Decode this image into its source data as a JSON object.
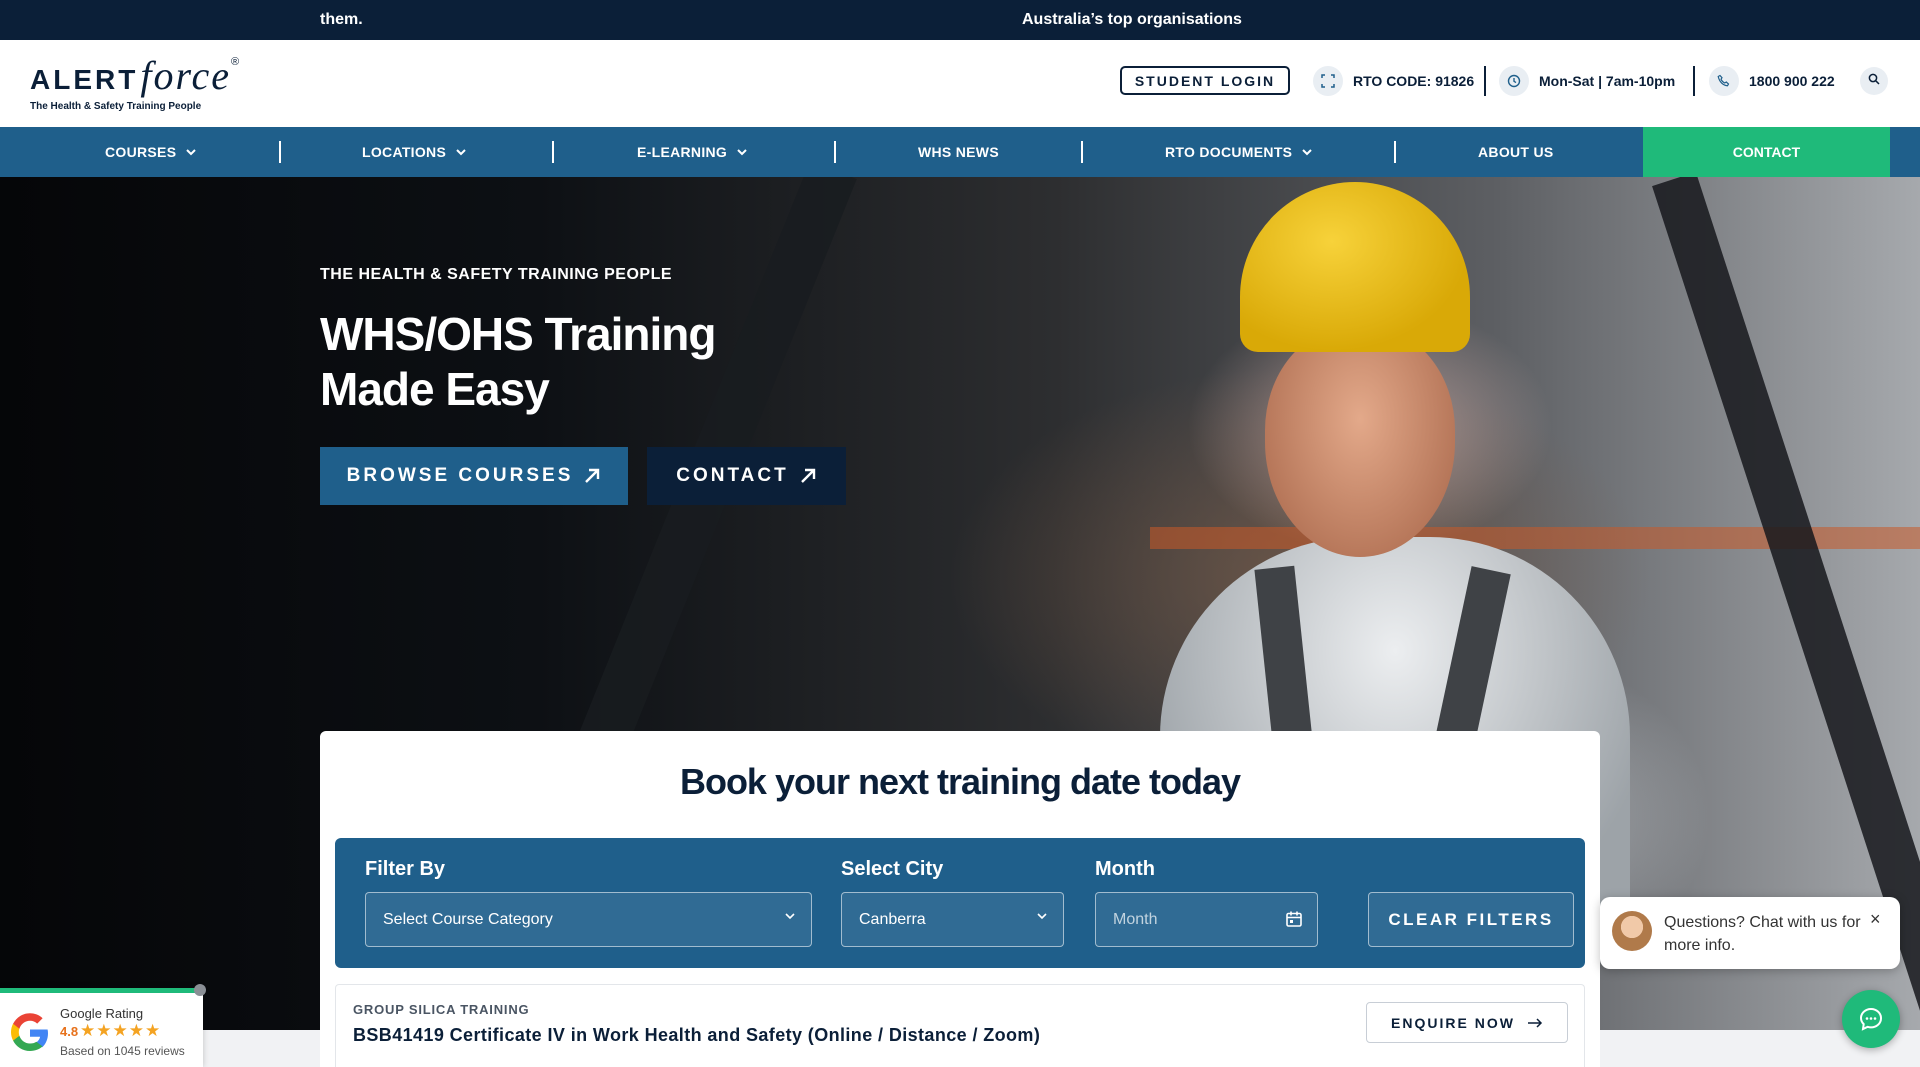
{
  "ticker": {
    "left_text": "them.",
    "right_text": "Australia’s top organisations"
  },
  "header": {
    "logo_word_alert": "ALERT",
    "logo_word_force": "force",
    "logo_reg": "®",
    "logo_tagline": "The Health & Safety Training People",
    "student_login": "STUDENT LOGIN",
    "rto_code": "RTO CODE: 91826",
    "hours": "Mon-Sat | 7am-10pm",
    "phone": "1800 900 222"
  },
  "nav": {
    "items": [
      {
        "label": "COURSES",
        "dropdown": true
      },
      {
        "label": "LOCATIONS",
        "dropdown": true
      },
      {
        "label": "E-LEARNING",
        "dropdown": true
      },
      {
        "label": "WHS NEWS",
        "dropdown": false
      },
      {
        "label": "RTO DOCUMENTS",
        "dropdown": true
      },
      {
        "label": "ABOUT US",
        "dropdown": false
      }
    ],
    "contact": "CONTACT"
  },
  "hero": {
    "eyebrow": "THE HEALTH & SAFETY TRAINING PEOPLE",
    "headline": "WHS/OHS Training Made Easy",
    "browse_label": "BROWSE COURSES",
    "contact_label": "CONTACT"
  },
  "booking": {
    "title": "Book your next training date today",
    "filter_by_label": "Filter By",
    "category_value": "Select Course Category",
    "city_label": "Select City",
    "city_value": "Canberra",
    "month_label": "Month",
    "month_placeholder": "Month",
    "clear_label": "CLEAR FILTERS",
    "course": {
      "category": "GROUP SILICA TRAINING",
      "title": "BSB41419 Certificate IV in Work Health and Safety (Online / Distance / Zoom)",
      "enquire_label": "ENQUIRE NOW"
    }
  },
  "google_rating": {
    "label": "Google Rating",
    "score": "4.8",
    "stars": "★★★★★",
    "reviews": "Based on 1045 reviews"
  },
  "chat": {
    "message": "Questions? Chat with us for more info.",
    "close": "×"
  },
  "colors": {
    "navy": "#0b1f38",
    "blue": "#1f5f8b",
    "green": "#1fba7a"
  },
  "icons": [
    "rto-badge-icon",
    "clock-icon",
    "phone-icon",
    "search-icon",
    "chevron-down-icon",
    "arrow-up-right-icon",
    "calendar-icon",
    "arrow-right-icon",
    "google-icon",
    "chat-icon",
    "close-icon"
  ]
}
